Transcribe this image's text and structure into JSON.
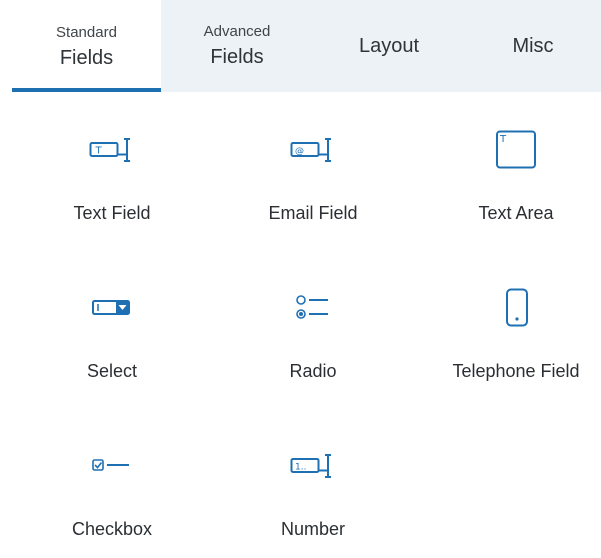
{
  "tabs": [
    {
      "small": "Standard",
      "big": "Fields",
      "active": true
    },
    {
      "small": "Advanced",
      "big": "Fields",
      "active": false
    },
    {
      "small": "",
      "big": "Layout",
      "active": false
    },
    {
      "small": "",
      "big": "Misc",
      "active": false
    }
  ],
  "fields": [
    {
      "label": "Text Field",
      "icon": "text-field-icon"
    },
    {
      "label": "Email Field",
      "icon": "email-field-icon"
    },
    {
      "label": "Text Area",
      "icon": "text-area-icon"
    },
    {
      "label": "Select",
      "icon": "select-icon"
    },
    {
      "label": "Radio",
      "icon": "radio-icon"
    },
    {
      "label": "Telephone Field",
      "icon": "telephone-field-icon"
    },
    {
      "label": "Checkbox",
      "icon": "checkbox-icon"
    },
    {
      "label": "Number",
      "icon": "number-field-icon"
    }
  ],
  "icon_glyphs": {
    "text_field": "T",
    "email_field": "@",
    "text_area": "T",
    "number_field": "1.."
  },
  "colors": {
    "accent": "#1f70b3",
    "inactive_tab_bg": "#edf2f7",
    "text": "#2b2f33"
  }
}
